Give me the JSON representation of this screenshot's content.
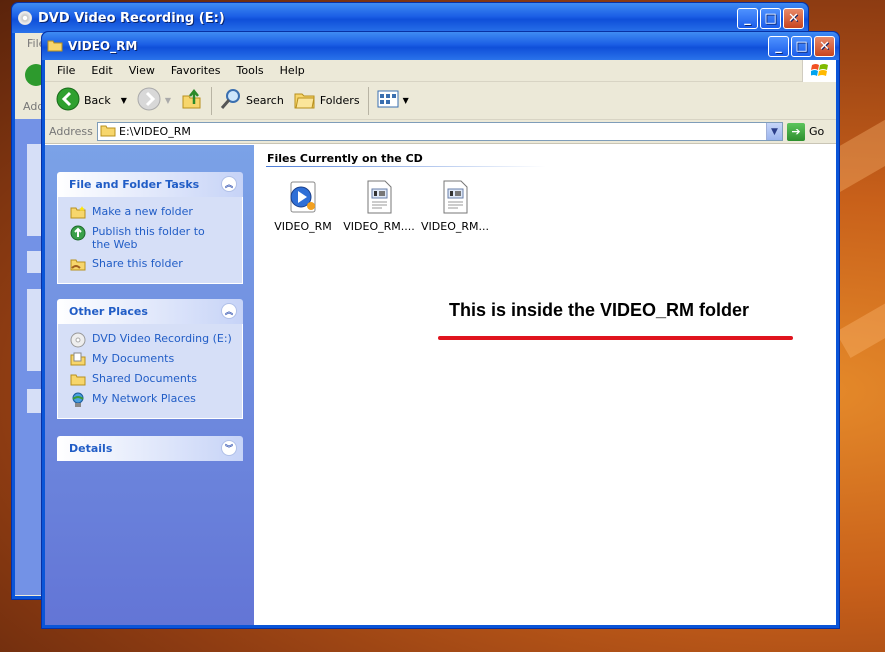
{
  "back_window": {
    "title": "DVD Video Recording (E:)",
    "menu_partial": "File",
    "address_partial": "Addr"
  },
  "window": {
    "title": "VIDEO_RM",
    "caption_buttons": {
      "minimize": "_",
      "maximize": "□",
      "close": "✕"
    }
  },
  "menu": [
    "File",
    "Edit",
    "View",
    "Favorites",
    "Tools",
    "Help"
  ],
  "toolbar": {
    "back_label": "Back",
    "search_label": "Search",
    "folders_label": "Folders"
  },
  "address": {
    "label": "Address",
    "value": "E:\\VIDEO_RM",
    "go_label": "Go"
  },
  "tasks_panel": {
    "title": "File and Folder Tasks",
    "items": [
      {
        "label": "Make a new folder",
        "icon": "new-folder-icon"
      },
      {
        "label": "Publish this folder to the Web",
        "icon": "publish-web-icon"
      },
      {
        "label": "Share this folder",
        "icon": "share-folder-icon"
      }
    ]
  },
  "places_panel": {
    "title": "Other Places",
    "items": [
      {
        "label": "DVD Video Recording (E:)",
        "icon": "dvd-drive-icon"
      },
      {
        "label": "My Documents",
        "icon": "my-documents-icon"
      },
      {
        "label": "Shared Documents",
        "icon": "shared-documents-icon"
      },
      {
        "label": "My Network Places",
        "icon": "network-places-icon"
      }
    ]
  },
  "details_panel": {
    "title": "Details"
  },
  "content": {
    "group_header": "Files Currently on the CD",
    "files": [
      {
        "name": "VIDEO_RM",
        "icon": "media-file-icon"
      },
      {
        "name": "VIDEO_RM....",
        "icon": "document-file-icon"
      },
      {
        "name": "VIDEO_RM...",
        "icon": "document-file-icon"
      }
    ]
  },
  "annotation": {
    "text": "This is inside the VIDEO_RM folder",
    "underline_color": "#e0141e"
  },
  "colors": {
    "titlebar": "#0f4fd9",
    "task_link": "#215dc6",
    "task_pane": "#6f8fe0"
  }
}
